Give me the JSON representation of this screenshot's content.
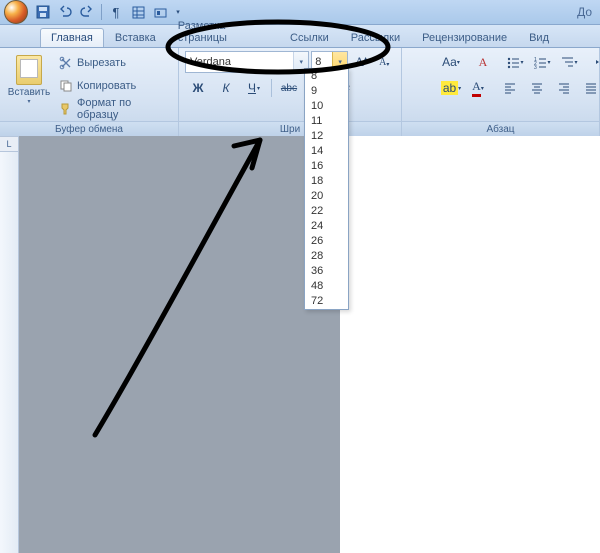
{
  "title_fragment": "До",
  "tabs": {
    "home": "Главная",
    "insert": "Вставка",
    "layout": "Разметка страницы",
    "refs": "Ссылки",
    "mail": "Рассылки",
    "review": "Рецензирование",
    "view": "Вид"
  },
  "clipboard": {
    "paste": "Вставить",
    "cut": "Вырезать",
    "copy": "Копировать",
    "format_painter": "Формат по образцу",
    "group_label": "Буфер обмена"
  },
  "font": {
    "name": "Verdana",
    "size": "8",
    "group_label": "Шри",
    "bold": "Ж",
    "italic": "К",
    "underline": "Ч",
    "strike": "abє",
    "sub": "x",
    "grow": "A",
    "shrink": "A",
    "highlight": "ab",
    "color": "A",
    "aa": "Aa",
    "clear": "A"
  },
  "font_sizes": [
    "8",
    "9",
    "10",
    "11",
    "12",
    "14",
    "16",
    "18",
    "20",
    "22",
    "24",
    "26",
    "28",
    "36",
    "48",
    "72"
  ],
  "paragraph": {
    "group_label": "Абзац"
  },
  "ruler_corner": "L"
}
